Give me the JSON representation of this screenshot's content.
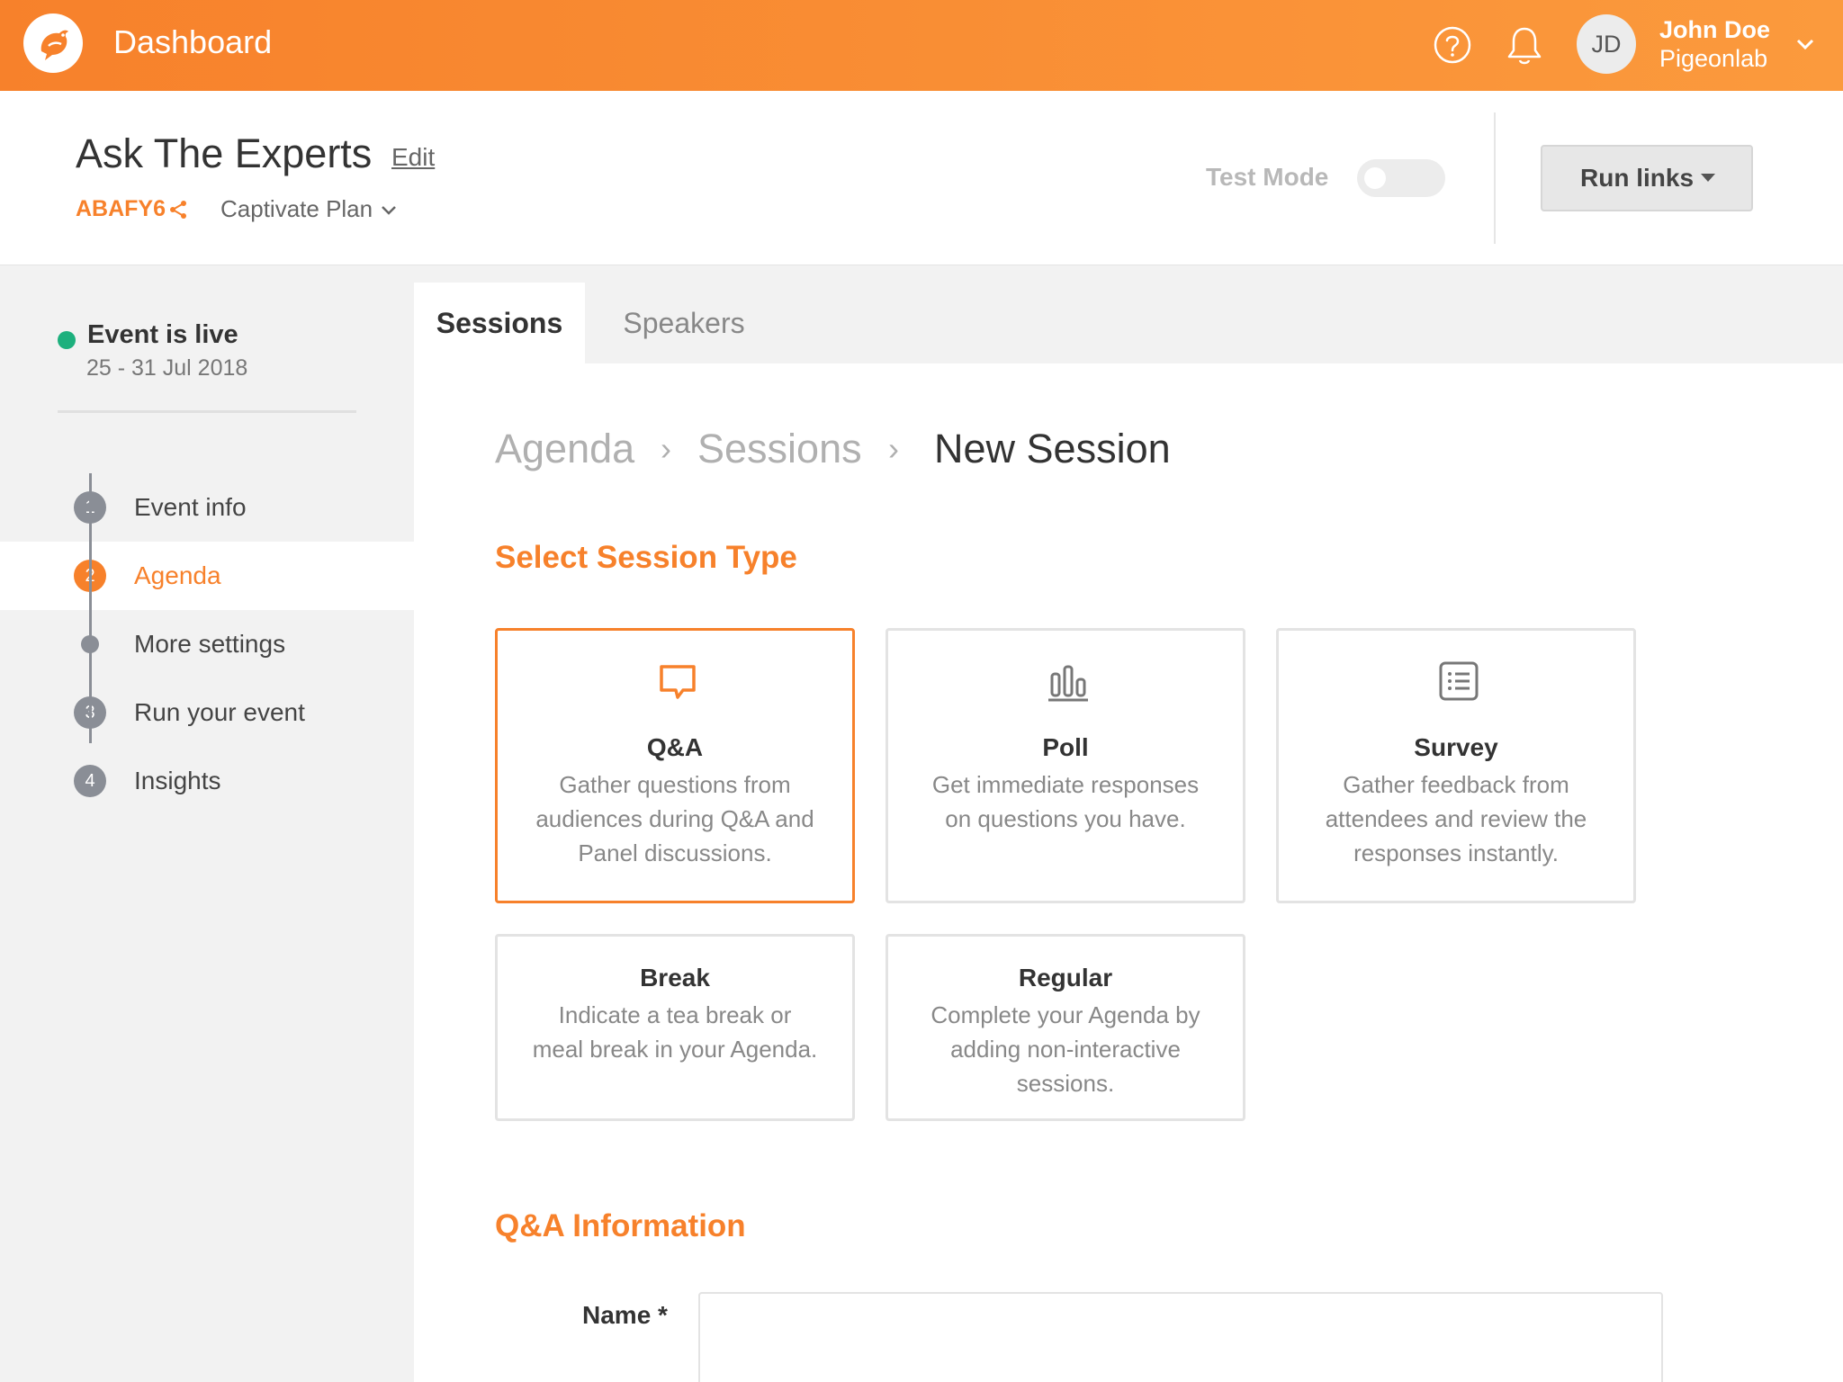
{
  "topbar": {
    "title": "Dashboard",
    "user": {
      "initials": "JD",
      "name": "John Doe",
      "org": "Pigeonlab"
    }
  },
  "event": {
    "title": "Ask The Experts",
    "edit_label": "Edit",
    "code": "ABAFY6",
    "plan": "Captivate Plan",
    "test_mode_label": "Test Mode",
    "test_mode_on": false,
    "run_links_label": "Run links"
  },
  "sidebar": {
    "status": "Event is live",
    "dates": "25 - 31 Jul 2018",
    "steps": [
      {
        "number": "1",
        "label": "Event info"
      },
      {
        "number": "2",
        "label": "Agenda"
      },
      {
        "number": "",
        "label": "More settings"
      },
      {
        "number": "3",
        "label": "Run your event"
      },
      {
        "number": "4",
        "label": "Insights"
      }
    ]
  },
  "tabs": {
    "sessions": "Sessions",
    "speakers": "Speakers"
  },
  "breadcrumb": {
    "root": "Agenda",
    "parent": "Sessions",
    "current": "New Session",
    "separator": "›"
  },
  "session_types": {
    "title": "Select Session Type",
    "cards": [
      {
        "title": "Q&A",
        "description": "Gather questions from audiences during Q&A and Panel discussions.",
        "icon": "chat-bubble-icon"
      },
      {
        "title": "Poll",
        "description": "Get immediate responses on questions you have.",
        "icon": "bar-chart-icon"
      },
      {
        "title": "Survey",
        "description": "Gather feedback from attendees and review the responses instantly.",
        "icon": "checklist-icon"
      },
      {
        "title": "Break",
        "description": "Indicate a tea break or meal break in your Agenda."
      },
      {
        "title": "Regular",
        "description": "Complete your Agenda by adding non-interactive sessions."
      }
    ]
  },
  "qa_info": {
    "title": "Q&A Information",
    "name_label": "Name *",
    "name_value": ""
  },
  "colors": {
    "accent": "#f7812b",
    "live": "#1db07d",
    "step_gray": "#8a8e96"
  }
}
